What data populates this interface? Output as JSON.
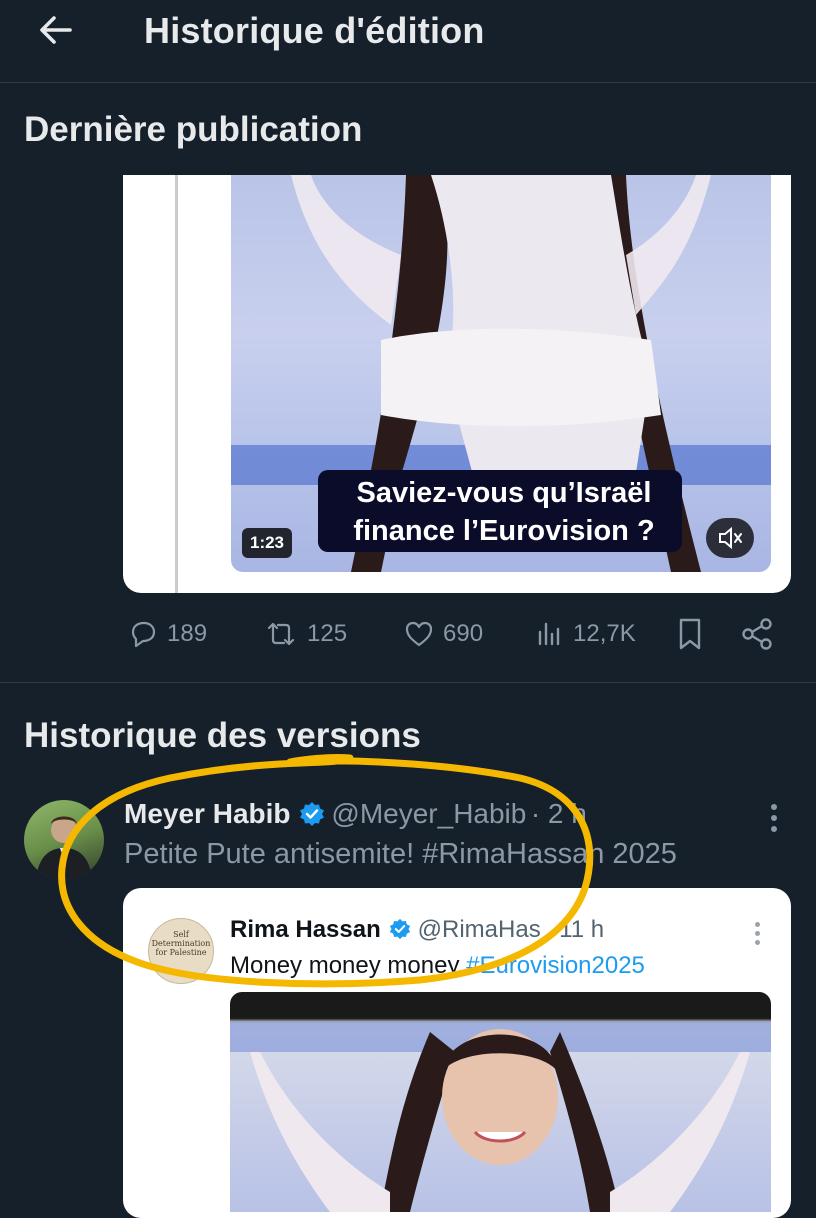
{
  "header": {
    "title": "Historique d'édition",
    "back_icon": "back-arrow-icon"
  },
  "latest": {
    "section_title": "Dernière publication",
    "video": {
      "duration": "1:23",
      "caption_line1": "Saviez-vous qu’Israël",
      "caption_line2": "finance l’Eurovision ?"
    },
    "stats": {
      "replies": "189",
      "reposts": "125",
      "likes": "690",
      "views": "12,7K"
    }
  },
  "history": {
    "section_title": "Historique des versions",
    "tweet": {
      "author_name": "Meyer Habib",
      "author_handle": "@Meyer_Habib",
      "time": "· 2 h",
      "text": "Petite Pute antisemite! #RimaHassan 2025",
      "quote": {
        "author_name": "Rima Hassan",
        "author_handle": "@RimaHas",
        "time": "11 h",
        "text_plain": "Money money money ",
        "hashtag": "#Eurovision2025",
        "avatar_text_1": "Self",
        "avatar_text_2": "Determination",
        "avatar_text_3": "for Palestine"
      }
    }
  },
  "colors": {
    "background": "#15202b",
    "accent": "#1d9bf0",
    "verified": "#1d9bf0",
    "highlight": "#f5b800",
    "muted": "#8b98a5"
  }
}
